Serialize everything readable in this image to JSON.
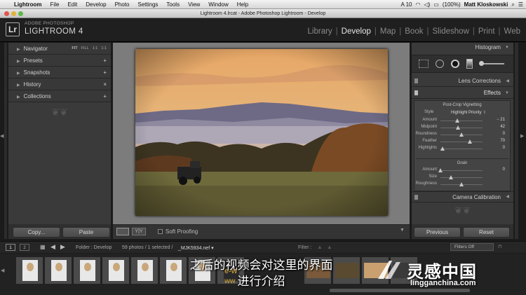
{
  "menubar": {
    "apple": "",
    "app": "Lightroom",
    "items": [
      "File",
      "Edit",
      "Develop",
      "Photo",
      "Settings",
      "Tools",
      "View",
      "Window",
      "Help"
    ],
    "status": {
      "battery": "(100%)",
      "user": "Matt Kloskowski",
      "adobe_badge": "A 10"
    }
  },
  "window": {
    "title": "Lightroom 4.lrcat - Adobe Photoshop Lightroom - Develop"
  },
  "identity": {
    "adobe": "ADOBE PHOTOSHOP",
    "product": "LIGHTROOM 4",
    "logo": "Lr"
  },
  "modules": {
    "items": [
      "Library",
      "Develop",
      "Map",
      "Book",
      "Slideshow",
      "Print",
      "Web"
    ],
    "active": "Develop"
  },
  "left_panel": {
    "navigator": {
      "label": "Navigator",
      "zoom": [
        "FIT",
        "FILL",
        "1:1",
        "1:1"
      ]
    },
    "presets": {
      "label": "Presets",
      "action": "+"
    },
    "snapshots": {
      "label": "Snapshots",
      "action": "+"
    },
    "history": {
      "label": "History",
      "action": "×"
    },
    "collections": {
      "label": "Collections",
      "action": "+"
    },
    "copy_button": "Copy...",
    "paste_button": "Paste"
  },
  "center": {
    "soft_proofing": "Soft Proofing",
    "view_mode": "Y|Y"
  },
  "right_panel": {
    "histogram": "Histogram",
    "lens_corrections": "Lens Corrections",
    "effects": {
      "label": "Effects",
      "post_crop_title": "Post-Crop Vignetting",
      "style_label": "Style",
      "style_value": "Highlight Priority",
      "sliders": [
        {
          "label": "Amount",
          "value": "− 21",
          "pos": 0.4
        },
        {
          "label": "Midpoint",
          "value": "42",
          "pos": 0.42
        },
        {
          "label": "Roundness",
          "value": "0",
          "pos": 0.5
        },
        {
          "label": "Feather",
          "value": "70",
          "pos": 0.7
        },
        {
          "label": "Highlights",
          "value": "0",
          "pos": 0.05
        }
      ],
      "grain_title": "Grain",
      "grain": [
        {
          "label": "Amount",
          "value": "0",
          "pos": 0.0
        },
        {
          "label": "Size",
          "value": "",
          "pos": 0.25
        },
        {
          "label": "Roughness",
          "value": "",
          "pos": 0.5
        }
      ]
    },
    "camera_calibration": "Camera Calibration",
    "previous_button": "Previous",
    "reset_button": "Reset"
  },
  "filmstrip_bar": {
    "screen1": "1",
    "screen2": "2",
    "folder": "Folder : Develop",
    "count": "59 photos / 1 selected /",
    "filename": "_MJK5934.nef",
    "filter_label": "Filter :",
    "filters_off": "Filters Off"
  },
  "subtitle": {
    "line1": "之后的视频会对这里的界面",
    "line2": "进行介绍"
  },
  "watermark": {
    "site": "lingganchina.com",
    "brand": "灵感中国",
    "left": "e-w",
    "left2": "ww"
  },
  "colors": {
    "panel": "#3a3a3a",
    "background": "#1b1b1b",
    "accent_text": "#e6e6e6"
  }
}
